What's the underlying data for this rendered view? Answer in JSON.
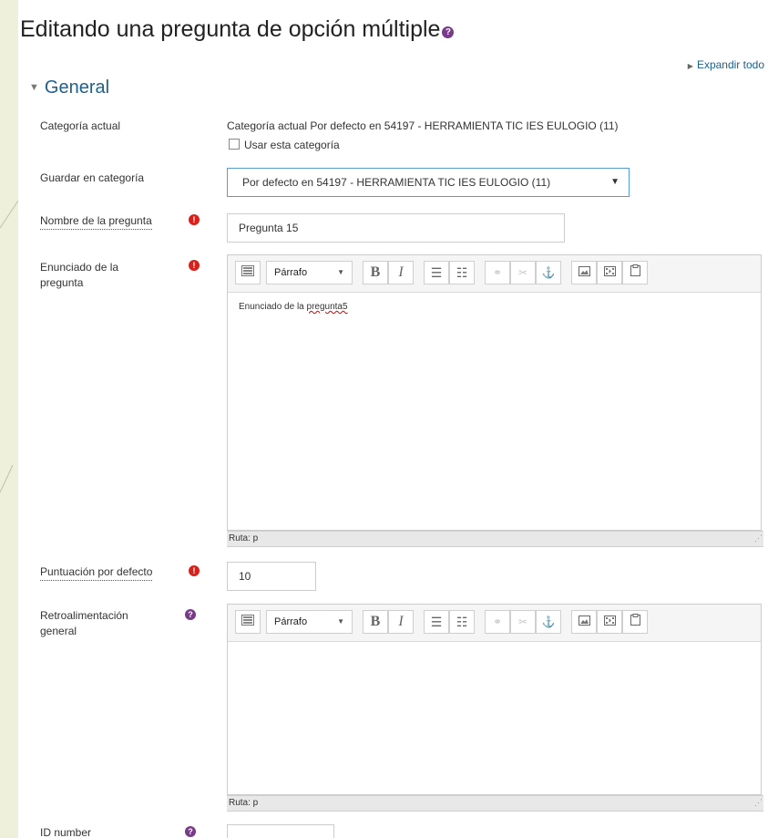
{
  "page": {
    "title": "Editando una pregunta de opción múltiple",
    "expand_all": "Expandir todo",
    "section": "General"
  },
  "fields": {
    "current_category": {
      "label": "Categoría actual",
      "value": "Categoría actual Por defecto en 54197 - HERRAMIENTA TIC IES EULOGIO (11)",
      "checkbox_label": "Usar esta categoría"
    },
    "save_category": {
      "label": "Guardar en categoría",
      "selected": "Por defecto en 54197 - HERRAMIENTA TIC IES EULOGIO (11)"
    },
    "question_name": {
      "label": "Nombre de la pregunta",
      "value": "Pregunta 15"
    },
    "question_text": {
      "label_line1": "Enunciado de la",
      "label_line2": "pregunta",
      "content_prefix": "Enunciado de la ",
      "content_spell": "pregunta5",
      "path": "Ruta: p"
    },
    "default_mark": {
      "label": "Puntuación por defecto",
      "value": "10"
    },
    "general_feedback": {
      "label_line1": "Retroalimentación",
      "label_line2": "general",
      "path": "Ruta: p"
    },
    "id_number": {
      "label": "ID number"
    }
  },
  "editor_toolbar": {
    "format_label": "Párrafo",
    "icons": [
      "kitchen-sink-icon",
      "bold-icon",
      "italic-icon",
      "unordered-list-icon",
      "ordered-list-icon",
      "link-icon",
      "unlink-icon",
      "anchor-icon",
      "image-icon",
      "media-icon",
      "paste-icon"
    ]
  },
  "colors": {
    "required": "#d9211b",
    "help": "#7a3a8a",
    "link": "#1f5f8b",
    "focus_border": "#5b9bd5"
  }
}
